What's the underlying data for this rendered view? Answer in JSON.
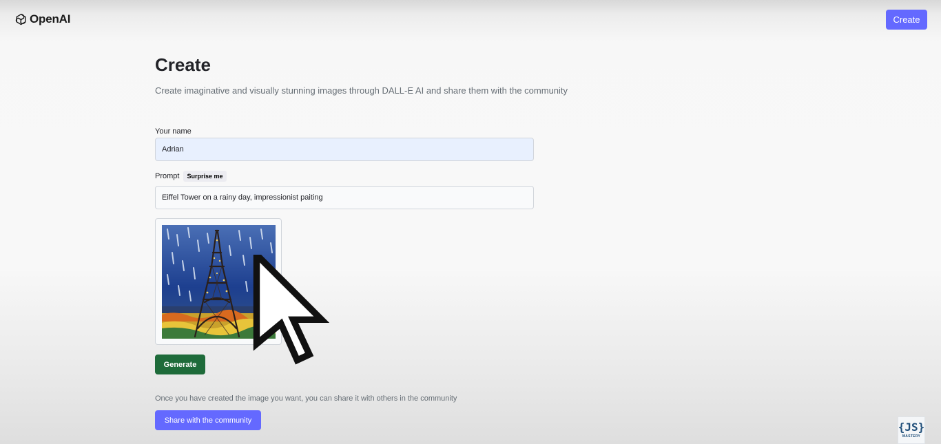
{
  "header": {
    "logo_text": "OpenAI",
    "create_label": "Create"
  },
  "page": {
    "title": "Create",
    "subtitle": "Create imaginative and visually stunning images through DALL-E AI and share them with the community"
  },
  "form": {
    "name_label": "Your name",
    "name_value": "Adrian",
    "prompt_label": "Prompt",
    "surprise_label": "Surprise me",
    "prompt_value": "Eiffel Tower on a rainy day, impressionist paiting"
  },
  "actions": {
    "generate_label": "Generate",
    "share_note": "Once you have created the image you want, you can share it with others in the community",
    "share_label": "Share with the community"
  },
  "badge": {
    "main": "{JS}",
    "sub": "MASTERY"
  },
  "colors": {
    "accent": "#6469ff",
    "generate": "#1e6b3a"
  }
}
